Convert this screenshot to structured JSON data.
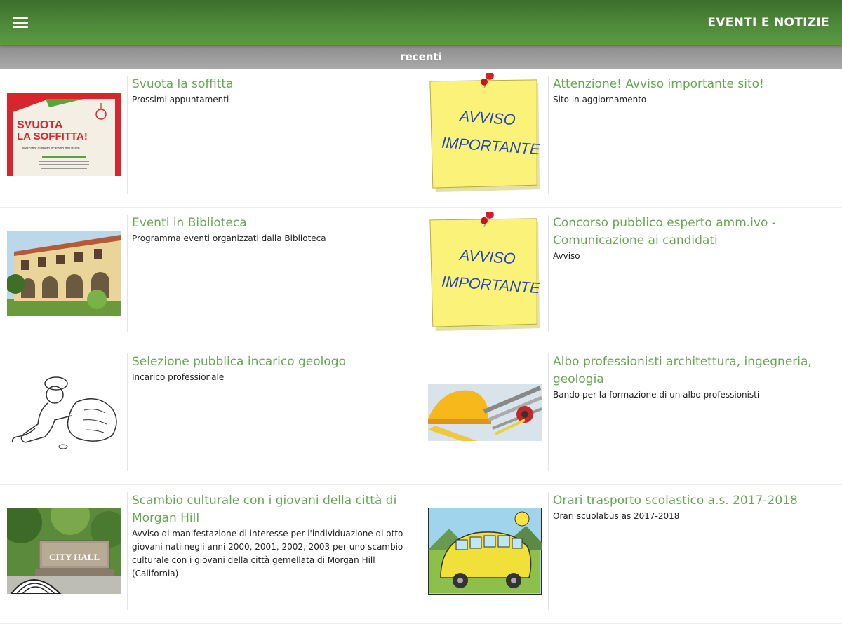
{
  "appbar": {
    "title": "EVENTI E NOTIZIE"
  },
  "section": {
    "title": "recenti"
  },
  "items": [
    {
      "title": "Svuota la soffitta",
      "desc": "Prossimi appuntamenti",
      "thumb": "svuota-la-soffitta-poster",
      "thumb_text": {
        "line1": "SVUOTA",
        "line2": "LA SOFFITTA!",
        "sub": "Mercatini di libero scambio dell'usato"
      }
    },
    {
      "title": "Attenzione! Avviso importante sito!",
      "desc": "Sito in aggiornamento",
      "thumb": "avviso-importante-note",
      "thumb_text": {
        "line1": "AVVISO",
        "line2": "IMPORTANTE"
      }
    },
    {
      "title": "Eventi in Biblioteca",
      "desc": "Programma eventi organizzati dalla Biblioteca",
      "thumb": "library-building-photo"
    },
    {
      "title": "Concorso pubblico esperto amm.ivo - Comunicazione ai candidati",
      "desc": "Avviso",
      "thumb": "avviso-importante-note",
      "thumb_text": {
        "line1": "AVVISO",
        "line2": "IMPORTANTE"
      }
    },
    {
      "title": "Selezione pubblica incarico geologo",
      "desc": "Incarico professionale",
      "thumb": "geologist-drawing"
    },
    {
      "title": "Albo professionisti architettura, ingegneria, geologia",
      "desc": "Bando per la formazione di un albo professionisti",
      "thumb": "hardhat-tools-photo"
    },
    {
      "title": "Scambio culturale con i giovani della città di Morgan Hill",
      "desc": "Avviso di manifestazione di interesse per l'individuazione di otto giovani nati negli anni 2000, 2001, 2002, 2003 per uno scambio culturale con i giovani della città gemellata di Morgan Hill (California)",
      "thumb": "city-hall-sign-photo",
      "thumb_text": {
        "line1": "CITY HALL"
      }
    },
    {
      "title": "Orari trasporto scolastico a.s. 2017-2018",
      "desc": "Orari scuolabus as 2017-2018",
      "thumb": "school-bus-cartoon"
    }
  ],
  "colors": {
    "appbar": "#4a8236",
    "title_green": "#6aa556",
    "section_bar": "#9b9b9b"
  }
}
